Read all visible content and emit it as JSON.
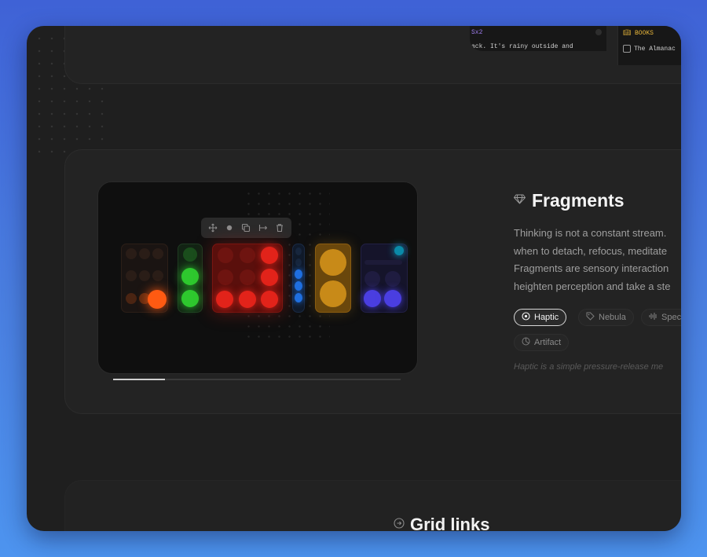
{
  "top_strip": {
    "note_tag": "Sx2",
    "note_text": "ack. It's rainy outside and",
    "books_header": "BOOKS",
    "books_item": "The Almanac"
  },
  "feature": {
    "title": "Fragments",
    "description_lines": [
      "Thinking is not a constant stream.",
      "when to detach, refocus, meditate",
      "Fragments are sensory interaction",
      "heighten perception and take a ste"
    ],
    "chips": [
      {
        "label": "Haptic",
        "icon": "target-icon",
        "active": true
      },
      {
        "label": "Nebula",
        "icon": "tag-icon",
        "active": false
      },
      {
        "label": "Spec",
        "icon": "waveform-icon",
        "active": false
      },
      {
        "label": "Artifact",
        "icon": "pie-icon",
        "active": false
      }
    ],
    "caption": "Haptic is a simple pressure-release me",
    "progress": 0.18
  },
  "preview": {
    "toolbar_tools": [
      "move-icon",
      "dot-icon",
      "copy-icon",
      "width-icon",
      "trash-icon"
    ]
  },
  "section": {
    "grid_links_title": "Grid links"
  },
  "colors": {
    "accent_red": "#e2231a",
    "accent_green": "#2ec82e",
    "accent_blue": "#1f6fe0",
    "accent_amber": "#d8921a",
    "accent_indigo": "#4a3ee0",
    "accent_orange": "#ff5a12"
  }
}
